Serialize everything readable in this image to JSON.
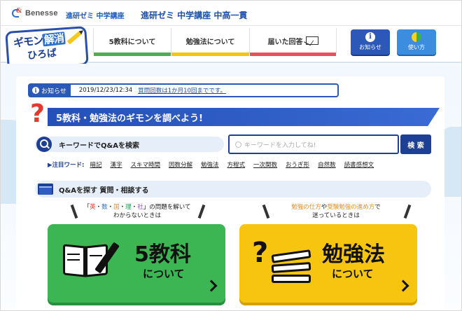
{
  "brand": {
    "benesse": "Benesse",
    "course_small": "進研ゼミ 中学講座",
    "course_big": "進研ゼミ 中学講座 中高一貫"
  },
  "logo": {
    "line1_a": "ギモン",
    "line1_b": "解消",
    "line2": "ひろば"
  },
  "nav": {
    "tabs": [
      {
        "label": "5教科について",
        "color": "#4cb050"
      },
      {
        "label": "勉強法について",
        "color": "#f7c510"
      },
      {
        "label": "届いた回答",
        "color": "#e8505a"
      }
    ],
    "info_label": "お知らせ",
    "howto_label": "使い方"
  },
  "notice": {
    "tag": "お知らせ",
    "date": "2019/12/23/12:34",
    "link": "質問回数は1か月10回までです。"
  },
  "banner": {
    "title": "5教科・勉強法のギモンを調べよう!"
  },
  "search": {
    "label": "キーワードでQ&Aを検索",
    "placeholder": "キーワードを入力してね!",
    "button": "検 索"
  },
  "keywords": {
    "head": "▶注目ワード:",
    "items": [
      "暗記",
      "漢字",
      "スキマ時間",
      "因数分解",
      "勉強法",
      "方程式",
      "一次関数",
      "おうぎ形",
      "自然数",
      "読書感想文"
    ]
  },
  "qa": {
    "title": "Q&Aを探す 質問・相談する"
  },
  "hints": {
    "left_open": "「",
    "left_s1": "英",
    "left_s2": "数",
    "left_s3": "国",
    "left_s4": "理",
    "left_s5": "社",
    "left_close": "」の問題を解いて",
    "left_line2": "わからないときは",
    "right_a": "勉強の仕方",
    "right_mid": "や",
    "right_b": "受験勉強の進め方",
    "right_end": "で",
    "right_line2": "迷っているときは"
  },
  "cards": {
    "subjects_big": "5教科",
    "subjects_sub": "について",
    "study_big": "勉強法",
    "study_sub": "について"
  }
}
